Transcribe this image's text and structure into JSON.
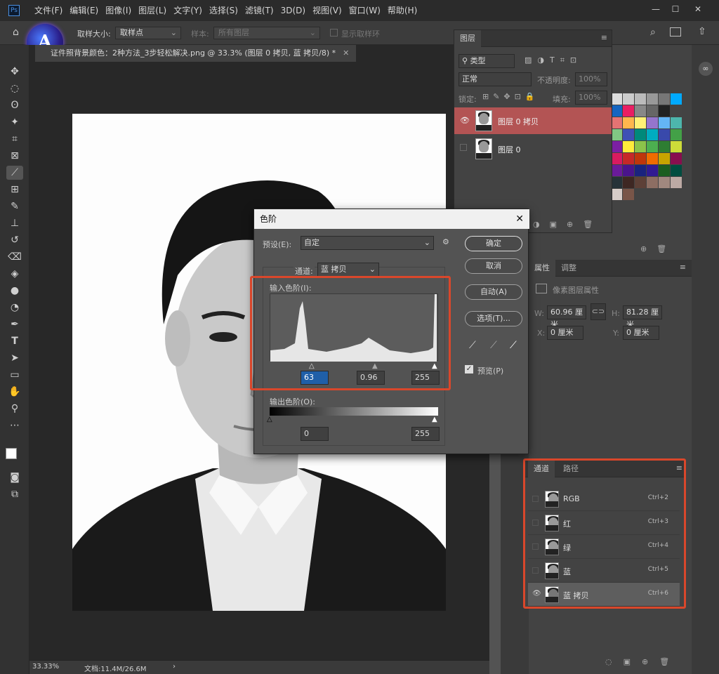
{
  "menubar": {
    "logo": "Ps",
    "items": [
      "文件(F)",
      "编辑(E)",
      "图像(I)",
      "图层(L)",
      "文字(Y)",
      "选择(S)",
      "滤镜(T)",
      "3D(D)",
      "视图(V)",
      "窗口(W)",
      "帮助(H)"
    ]
  },
  "options": {
    "sample_size_label": "取样大小:",
    "sample_size_value": "取样点",
    "sample_label": "样本:",
    "sample_value": "所有图层",
    "show_ring_label": "显示取样环"
  },
  "document": {
    "tab_title": "证件照背景颜色：2种方法_3步轻松解决.png @ 33.3% (图层 0 拷贝, 蓝 拷贝/8) *",
    "zoom": "33.33%",
    "doc_size": "文档:11.4M/26.6M"
  },
  "layers_panel": {
    "tab": "图层",
    "filter_value": "类型",
    "blend_mode": "正常",
    "opacity_label": "不透明度:",
    "opacity_value": "100%",
    "lock_label": "锁定:",
    "fill_label": "填充:",
    "fill_value": "100%",
    "layers": [
      {
        "name": "图层 0 拷贝",
        "visible": true,
        "selected": true
      },
      {
        "name": "图层 0",
        "visible": false,
        "selected": false
      }
    ]
  },
  "properties_panel": {
    "tabs": [
      "属性",
      "调整"
    ],
    "subtitle": "像素图层属性",
    "w_label": "W:",
    "w_value": "60.96 厘米",
    "h_label": "H:",
    "h_value": "81.28 厘米",
    "x_label": "X:",
    "x_value": "0 厘米",
    "y_label": "Y:",
    "y_value": "0 厘米"
  },
  "channels_panel": {
    "tabs": [
      "通道",
      "路径"
    ],
    "channels": [
      {
        "name": "RGB",
        "shortcut": "Ctrl+2",
        "visible": false
      },
      {
        "name": "红",
        "shortcut": "Ctrl+3",
        "visible": false
      },
      {
        "name": "绿",
        "shortcut": "Ctrl+4",
        "visible": false
      },
      {
        "name": "蓝",
        "shortcut": "Ctrl+5",
        "visible": false
      },
      {
        "name": "蓝 拷贝",
        "shortcut": "Ctrl+6",
        "visible": true
      }
    ]
  },
  "levels_dialog": {
    "title": "色阶",
    "preset_label": "预设(E):",
    "preset_value": "自定",
    "channel_label": "通道:",
    "channel_value": "蓝 拷贝",
    "input_label": "输入色阶(I):",
    "input_black": "63",
    "input_gamma": "0.96",
    "input_white": "255",
    "output_label": "输出色阶(O):",
    "output_black": "0",
    "output_white": "255",
    "ok": "确定",
    "cancel": "取消",
    "auto": "自动(A)",
    "options": "选项(T)...",
    "preview_label": "预览(P)",
    "preview_checked": true
  },
  "colors": {
    "accent_red": "#d9472b",
    "selected_layer": "#b35454"
  }
}
